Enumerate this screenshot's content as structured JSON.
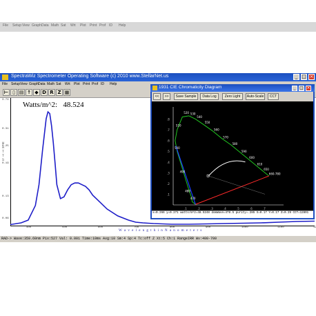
{
  "app": {
    "title": "SpectraWiz  Spectrometer Operating Software (c) 2010   www.StellarNet.us",
    "menu_faded": [
      "File",
      "Setup",
      "View",
      "Graph",
      "Data",
      "Math",
      "Sat",
      "Wrt",
      "Plot",
      "Print",
      "Prof",
      "ID",
      "Help"
    ],
    "menu_labels": [
      "File",
      "Setup",
      "View",
      "Graph",
      "Data",
      "Math",
      "Sat",
      "Wrt",
      "Plot",
      "Print",
      "Prof",
      "ID",
      "Help"
    ]
  },
  "toolbar": {
    "icons": [
      "open-icon",
      "save-icon",
      "print-icon",
      "up-arrow-icon",
      "refresh-icon",
      "dark-icon",
      "ref-icon",
      "zero-icon",
      "trend-icon"
    ],
    "glyphs": [
      "⊢",
      "▯",
      "▤",
      "↑",
      "◆",
      "D",
      "R",
      "Z",
      "▦"
    ]
  },
  "main_plot": {
    "reading_label": "Watts/m^2:",
    "reading_value": "48.524",
    "y_ticks": [
      "3.74",
      "0.31",
      "0.25",
      "0.19",
      "0.13",
      "0.06"
    ],
    "x_ticks": [
      "400",
      "500",
      "600",
      "700",
      "800",
      "900",
      "1000",
      "1100",
      "1200"
    ],
    "xlabel": "W a v e l e n g t h   i n   N a n o m e t e r s",
    "ylabel": "W A T T S"
  },
  "status": {
    "text": "RAD-> Wave:359.60nm  Pix:527  Val: 0.001  Time:10ms  Avg:10  Sm:4  Sp:4  Tc:off  Z  Xt:5  Ch:1 RangeIRR  Wv:400-700"
  },
  "cie": {
    "title": "1931 CIE Chromaticity Diagram",
    "buttons": [
      "<<",
      ">>",
      "Save Sample",
      "Data Log",
      "Zero Light",
      "Auto-Scale",
      "CCT"
    ],
    "status": "x=0.266 y=0.271 watts/m^2=48.5248  domWave=478.5  purity=.285  X=0.17  Y=0.17  Z=0.29  CCT=12891",
    "y_ticks": [
      ".8",
      ".7",
      ".6",
      ".5",
      ".4",
      ".3",
      ".2",
      ".1"
    ],
    "x_ticks": [
      ".1",
      ".2",
      ".3",
      ".4",
      ".5",
      ".6",
      ".7"
    ],
    "wavelength_labels": [
      "520",
      "530",
      "540",
      "510",
      "550",
      "560",
      "570",
      "500",
      "580",
      "590",
      "600",
      "610",
      "490",
      "650",
      "660-780",
      "480",
      "470"
    ],
    "colors": {
      "background": "#000000",
      "locus_green": "#21c521",
      "locus_blue": "#1a3cff",
      "locus_red": "#ff2a2a",
      "planck": "#ffffff"
    }
  },
  "chart_data": {
    "type": "line",
    "title": "",
    "xlabel": "Wavelength in Nanometers",
    "ylabel": "Watts",
    "xlim": [
      350,
      1200
    ],
    "ylim": [
      0,
      0.37
    ],
    "series": [
      {
        "values_x": [
          350,
          380,
          400,
          420,
          430,
          440,
          450,
          455,
          460,
          465,
          470,
          475,
          480,
          490,
          500,
          510,
          520,
          530,
          540,
          550,
          560,
          570,
          580,
          600,
          620,
          650,
          680,
          700,
          720,
          750,
          800,
          850,
          900,
          950,
          1000,
          1050,
          1100,
          1150,
          1200
        ],
        "values_y": [
          0.005,
          0.01,
          0.018,
          0.06,
          0.12,
          0.22,
          0.31,
          0.33,
          0.325,
          0.29,
          0.24,
          0.18,
          0.12,
          0.08,
          0.085,
          0.105,
          0.12,
          0.125,
          0.125,
          0.12,
          0.115,
          0.105,
          0.09,
          0.07,
          0.05,
          0.03,
          0.018,
          0.012,
          0.01,
          0.008,
          0.006,
          0.006,
          0.007,
          0.008,
          0.009,
          0.01,
          0.012,
          0.014,
          0.015
        ]
      }
    ]
  }
}
